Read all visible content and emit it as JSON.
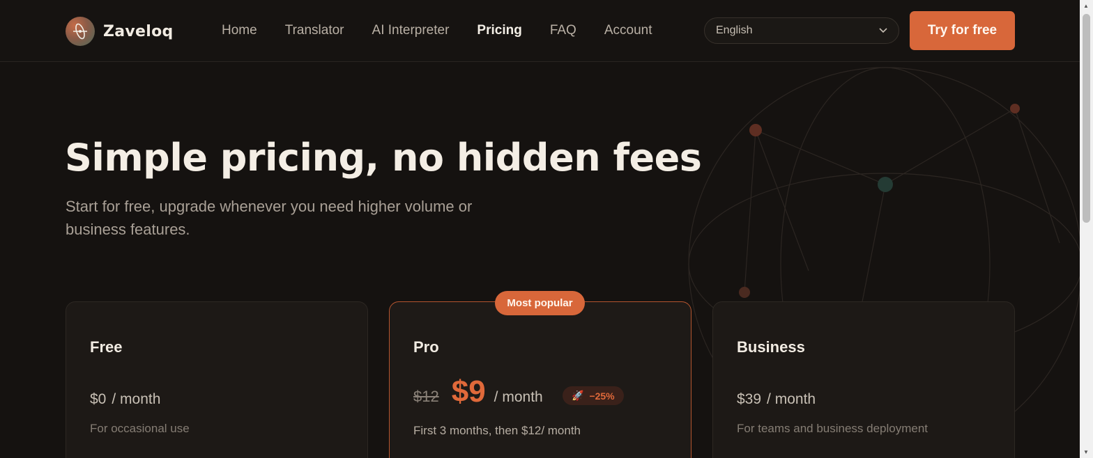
{
  "brand": {
    "name": "Zaveloq",
    "logo_icon": "orbit-logo-icon"
  },
  "nav": {
    "items": [
      {
        "label": "Home",
        "active": false
      },
      {
        "label": "Translator",
        "active": false
      },
      {
        "label": "AI Interpreter",
        "active": false
      },
      {
        "label": "Pricing",
        "active": true
      },
      {
        "label": "FAQ",
        "active": false
      },
      {
        "label": "Account",
        "active": false
      }
    ]
  },
  "language": {
    "selected": "English",
    "icon": "chevron-down-icon"
  },
  "cta": {
    "label": "Try for free"
  },
  "hero": {
    "title": "Simple pricing, no hidden fees",
    "subtitle": "Start for free, upgrade whenever you need higher volume or business features."
  },
  "plans": {
    "free": {
      "name": "Free",
      "price": "$0",
      "period": "/ month",
      "description": "For occasional use"
    },
    "pro": {
      "badge": "Most popular",
      "name": "Pro",
      "old_price": "$12",
      "price": "$9",
      "period": "/ month",
      "discount": "−25%",
      "discount_icon": "rocket-icon",
      "note": "First 3 months, then $12/ month"
    },
    "business": {
      "name": "Business",
      "price": "$39",
      "period": "/ month",
      "description": "For teams and business deployment"
    }
  },
  "colors": {
    "accent": "#d8673a",
    "background": "#151210",
    "card": "#1d1916"
  }
}
